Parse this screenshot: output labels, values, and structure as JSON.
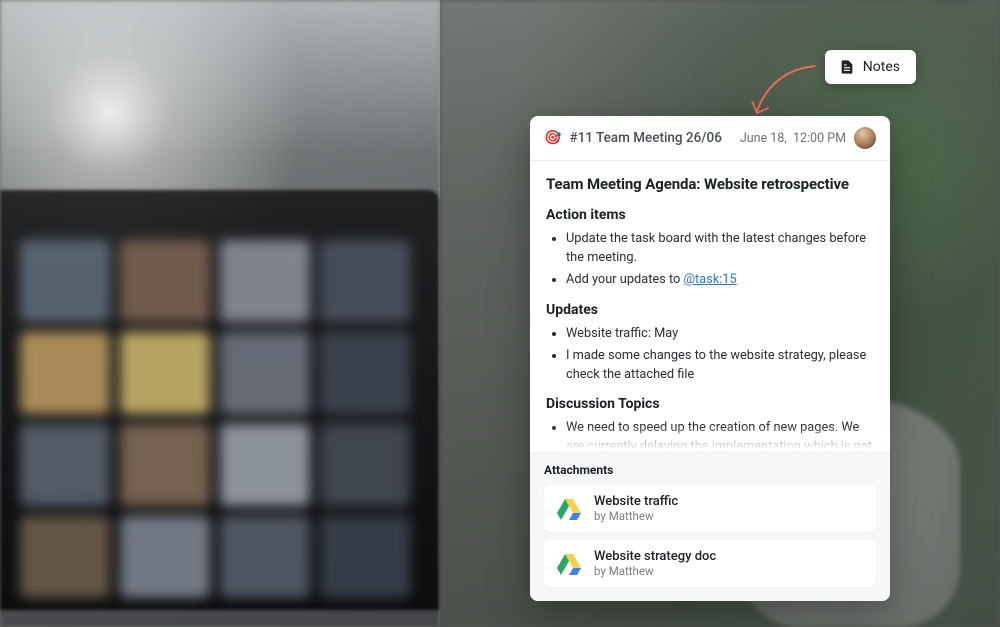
{
  "notes_button": {
    "label": "Notes"
  },
  "card": {
    "emoji": "🎯",
    "title": "#11 Team Meeting 26/06",
    "date": "June 18,",
    "time": "12:00 PM",
    "main_title": "Team Meeting Agenda: Website retrospective",
    "sections": {
      "action_items": {
        "heading": "Action items",
        "items": [
          "Update the task board with the latest changes before the meeting.",
          {
            "prefix": "Add your updates to ",
            "link": "@task:15"
          }
        ]
      },
      "updates": {
        "heading": "Updates",
        "items": [
          "Website traffic: May",
          "I made some changes to the website strategy, please check the attached file"
        ]
      },
      "discussion": {
        "heading": "Discussion Topics",
        "items": [
          "We need to speed up the creation of new pages. We are currently delaying the implementation which is not great for"
        ]
      }
    },
    "attachments_label": "Attachments",
    "attachments": [
      {
        "name": "Website traffic",
        "by": "by Matthew",
        "icon": "gdrive-icon"
      },
      {
        "name": "Website strategy doc",
        "by": "by Matthew",
        "icon": "gdrive-icon"
      }
    ]
  },
  "colors": {
    "link": "#2873e8",
    "arrow": "#ed6a5a"
  }
}
